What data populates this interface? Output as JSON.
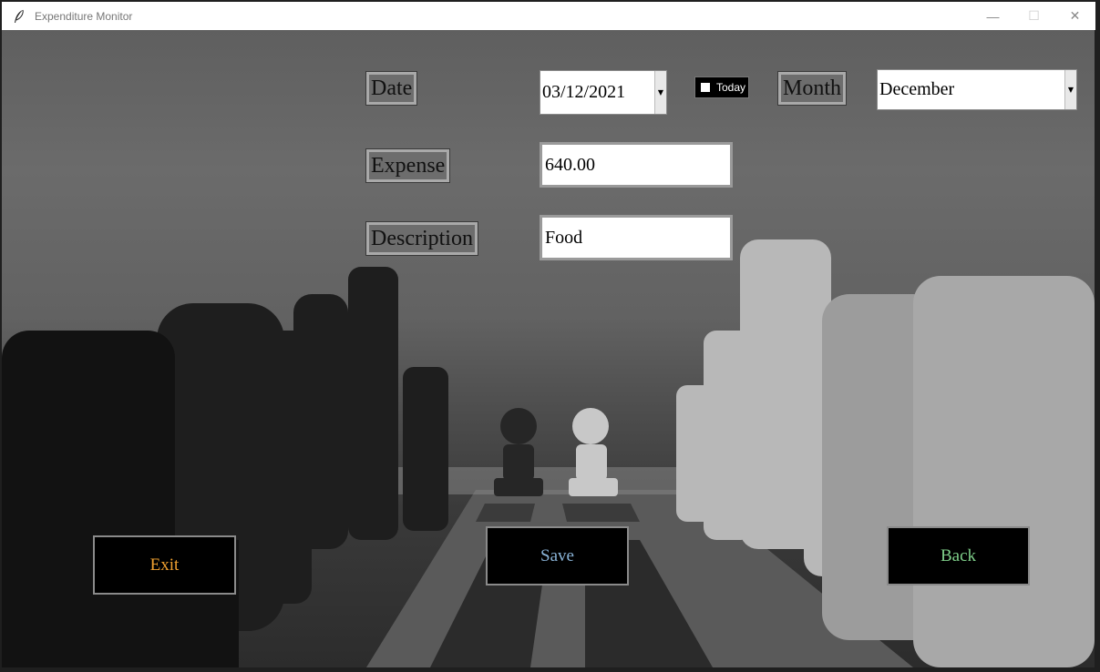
{
  "window": {
    "title": "Expenditure Monitor",
    "controls": {
      "minimize": "—",
      "maximize": "☐",
      "close": "✕"
    }
  },
  "form": {
    "date_label": "Date",
    "date_value": "03/12/2021",
    "today_label": "Today",
    "today_checked": false,
    "month_label": "Month",
    "month_value": "December",
    "expense_label": "Expense",
    "expense_value": "640.00",
    "description_label": "Description",
    "description_value": "Food"
  },
  "buttons": {
    "exit": {
      "label": "Exit",
      "color": "#f0a030"
    },
    "save": {
      "label": "Save",
      "color": "#8ab4d8"
    },
    "back": {
      "label": "Back",
      "color": "#7fd08a"
    }
  },
  "background": "chess-pieces-photo"
}
